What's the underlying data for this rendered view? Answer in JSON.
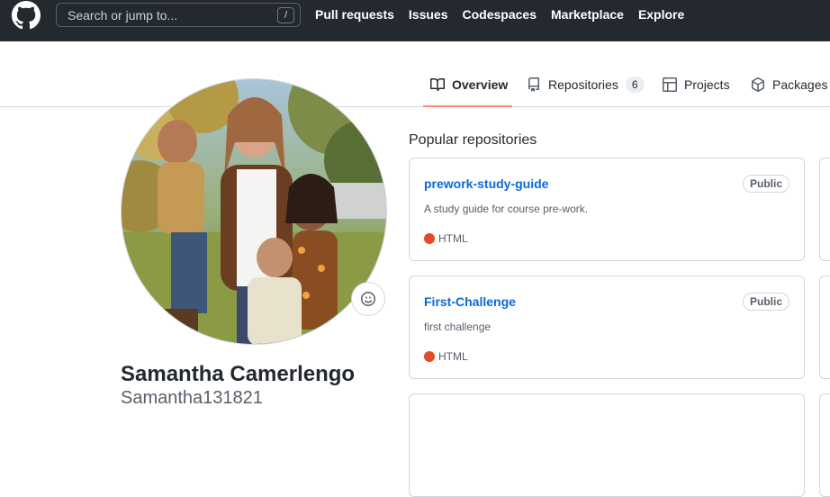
{
  "header": {
    "search_placeholder": "Search or jump to...",
    "search_shortcut": "/",
    "nav": [
      "Pull requests",
      "Issues",
      "Codespaces",
      "Marketplace",
      "Explore"
    ]
  },
  "tabs": {
    "overview": "Overview",
    "repositories": "Repositories",
    "repositories_count": "6",
    "projects": "Projects",
    "packages": "Packages"
  },
  "profile": {
    "name": "Samantha Camerlengo",
    "login": "Samantha131821"
  },
  "popular": {
    "title": "Popular repositories",
    "repos": [
      {
        "name": "prework-study-guide",
        "visibility": "Public",
        "description": "A study guide for course pre-work.",
        "language": "HTML",
        "language_color": "#e34c26"
      },
      {
        "name": "First-Challenge",
        "visibility": "Public",
        "description": "first challenge",
        "language": "HTML",
        "language_color": "#e34c26"
      }
    ]
  },
  "colors": {
    "header_bg": "#24292f",
    "link": "#0969da",
    "tab_underline": "#fd8c73"
  }
}
